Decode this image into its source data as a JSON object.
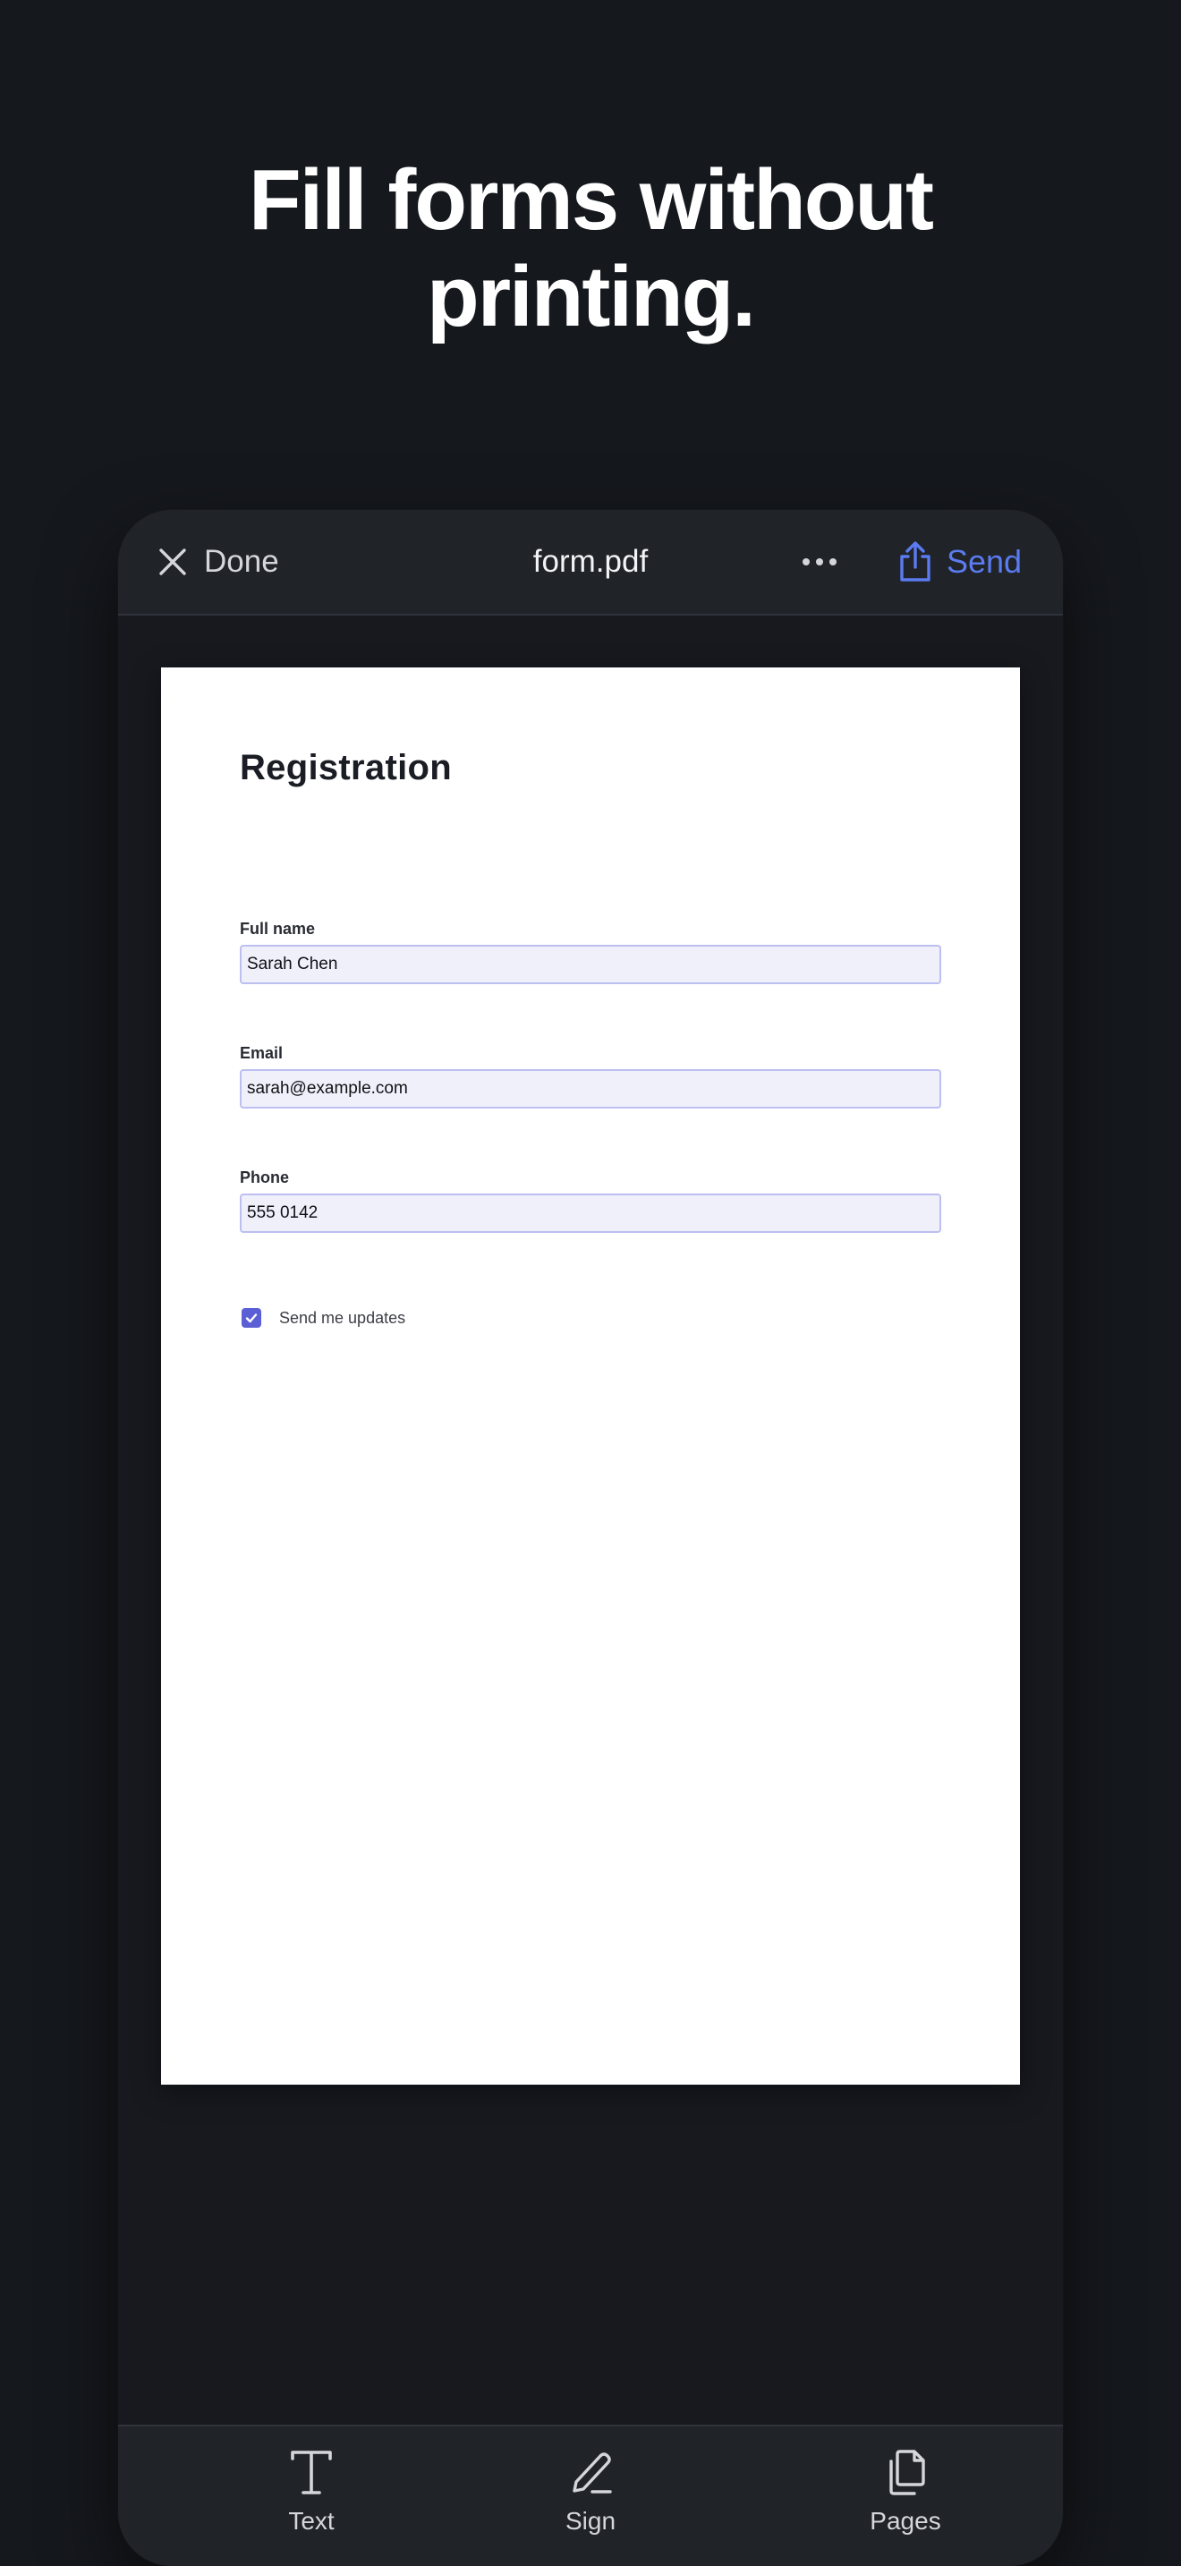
{
  "headline": {
    "line1": "Fill forms without",
    "line2": "printing."
  },
  "topbar": {
    "done_label": "Done",
    "title": "form.pdf",
    "send_label": "Send"
  },
  "form": {
    "title": "Registration",
    "fields": [
      {
        "label": "Full name",
        "value": "Sarah Chen"
      },
      {
        "label": "Email",
        "value": "sarah@example.com"
      },
      {
        "label": "Phone",
        "value": "555 0142"
      }
    ],
    "checkbox": {
      "label": "Send me updates",
      "checked": true
    }
  },
  "toolbar": {
    "items": [
      {
        "label": "Text",
        "icon": "text-icon"
      },
      {
        "label": "Sign",
        "icon": "pen-icon"
      },
      {
        "label": "Pages",
        "icon": "pages-icon"
      }
    ]
  },
  "colors": {
    "background": "#15181d",
    "accent": "#5b7bf0",
    "field_fill": "#f0f0fb",
    "field_border": "#bcbff0",
    "checkbox": "#5b5fd6"
  }
}
